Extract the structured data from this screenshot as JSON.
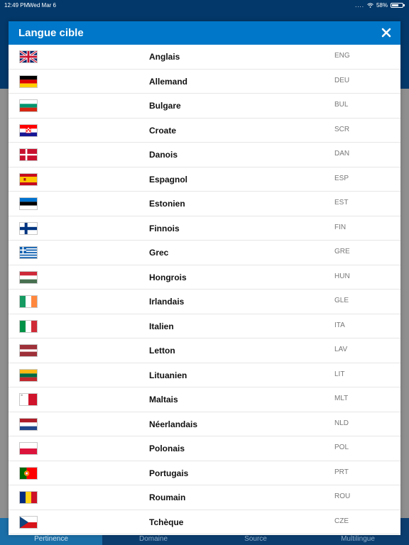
{
  "status_bar": {
    "time": "12:49 PM",
    "date": "Wed Mar 6",
    "battery": "58%",
    "battery_level": 0.58
  },
  "modal": {
    "title": "Langue cible"
  },
  "tabs": [
    {
      "label": "Pertinence",
      "active": true
    },
    {
      "label": "Domaine",
      "active": false
    },
    {
      "label": "Source",
      "active": false
    },
    {
      "label": "Multilingue",
      "active": false
    }
  ],
  "colors": {
    "modal_header": "#0077c8",
    "app_header": "#03386a",
    "tab_bar": "#0c3e70",
    "tab_active": "#1b6fa8"
  },
  "languages": [
    {
      "name": "Anglais",
      "code": "ENG",
      "flag": "uk-flag-icon"
    },
    {
      "name": "Allemand",
      "code": "DEU",
      "flag": "germany-flag-icon"
    },
    {
      "name": "Bulgare",
      "code": "BUL",
      "flag": "bulgaria-flag-icon"
    },
    {
      "name": "Croate",
      "code": "SCR",
      "flag": "croatia-flag-icon"
    },
    {
      "name": "Danois",
      "code": "DAN",
      "flag": "denmark-flag-icon"
    },
    {
      "name": "Espagnol",
      "code": "ESP",
      "flag": "spain-flag-icon"
    },
    {
      "name": "Estonien",
      "code": "EST",
      "flag": "estonia-flag-icon"
    },
    {
      "name": "Finnois",
      "code": "FIN",
      "flag": "finland-flag-icon"
    },
    {
      "name": "Grec",
      "code": "GRE",
      "flag": "greece-flag-icon"
    },
    {
      "name": "Hongrois",
      "code": "HUN",
      "flag": "hungary-flag-icon"
    },
    {
      "name": "Irlandais",
      "code": "GLE",
      "flag": "ireland-flag-icon"
    },
    {
      "name": "Italien",
      "code": "ITA",
      "flag": "italy-flag-icon"
    },
    {
      "name": "Letton",
      "code": "LAV",
      "flag": "latvia-flag-icon"
    },
    {
      "name": "Lituanien",
      "code": "LIT",
      "flag": "lithuania-flag-icon"
    },
    {
      "name": "Maltais",
      "code": "MLT",
      "flag": "malta-flag-icon"
    },
    {
      "name": "Néerlandais",
      "code": "NLD",
      "flag": "netherlands-flag-icon"
    },
    {
      "name": "Polonais",
      "code": "POL",
      "flag": "poland-flag-icon"
    },
    {
      "name": "Portugais",
      "code": "PRT",
      "flag": "portugal-flag-icon"
    },
    {
      "name": "Roumain",
      "code": "ROU",
      "flag": "romania-flag-icon"
    },
    {
      "name": "Tchèque",
      "code": "CZE",
      "flag": "czech-flag-icon"
    }
  ]
}
